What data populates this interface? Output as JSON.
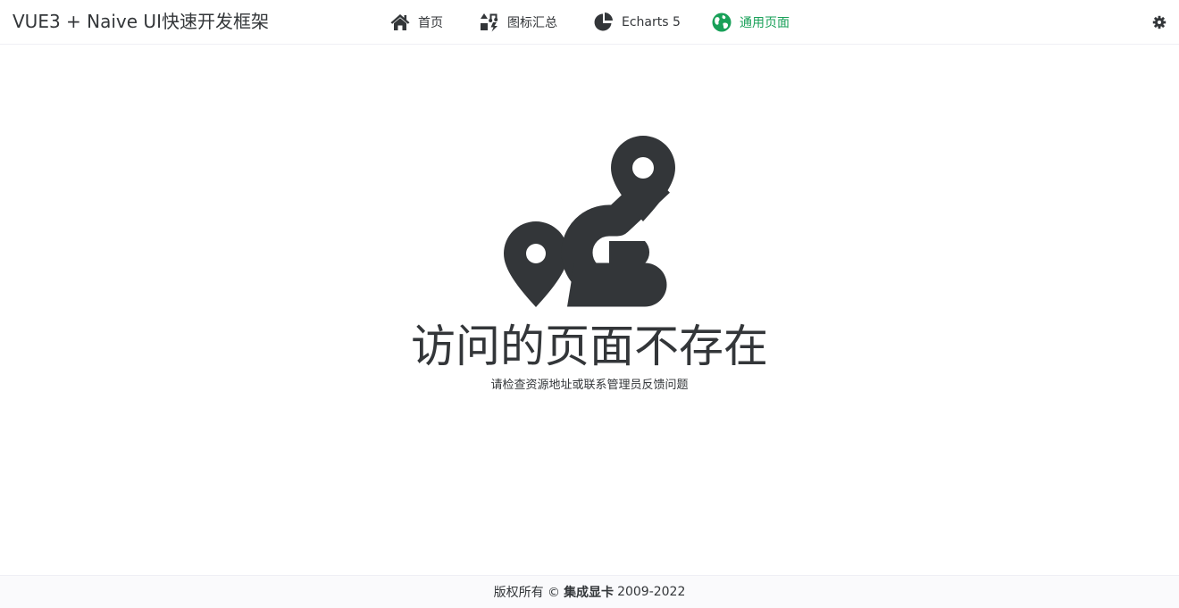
{
  "header": {
    "app_title": "VUE3 + Naive UI快速开发框架",
    "nav": [
      {
        "label": "首页",
        "icon": "home-icon"
      },
      {
        "label": "图标汇总",
        "icon": "icons-collection-icon"
      },
      {
        "label": "Echarts 5",
        "icon": "pie-chart-icon"
      },
      {
        "label": "通用页面",
        "icon": "globe-icon",
        "active": true
      }
    ],
    "settings_icon": "gear-icon"
  },
  "error": {
    "illustration": "route-map-pin-icon",
    "title": "访问的页面不存在",
    "description": "请检查资源地址或联系管理员反馈问题"
  },
  "footer": {
    "prefix": "版权所有 ©",
    "company": "集成显卡",
    "years": "2009-2022"
  },
  "colors": {
    "accent": "#18a058",
    "text": "#333639",
    "footer_bg": "#fafafc"
  }
}
